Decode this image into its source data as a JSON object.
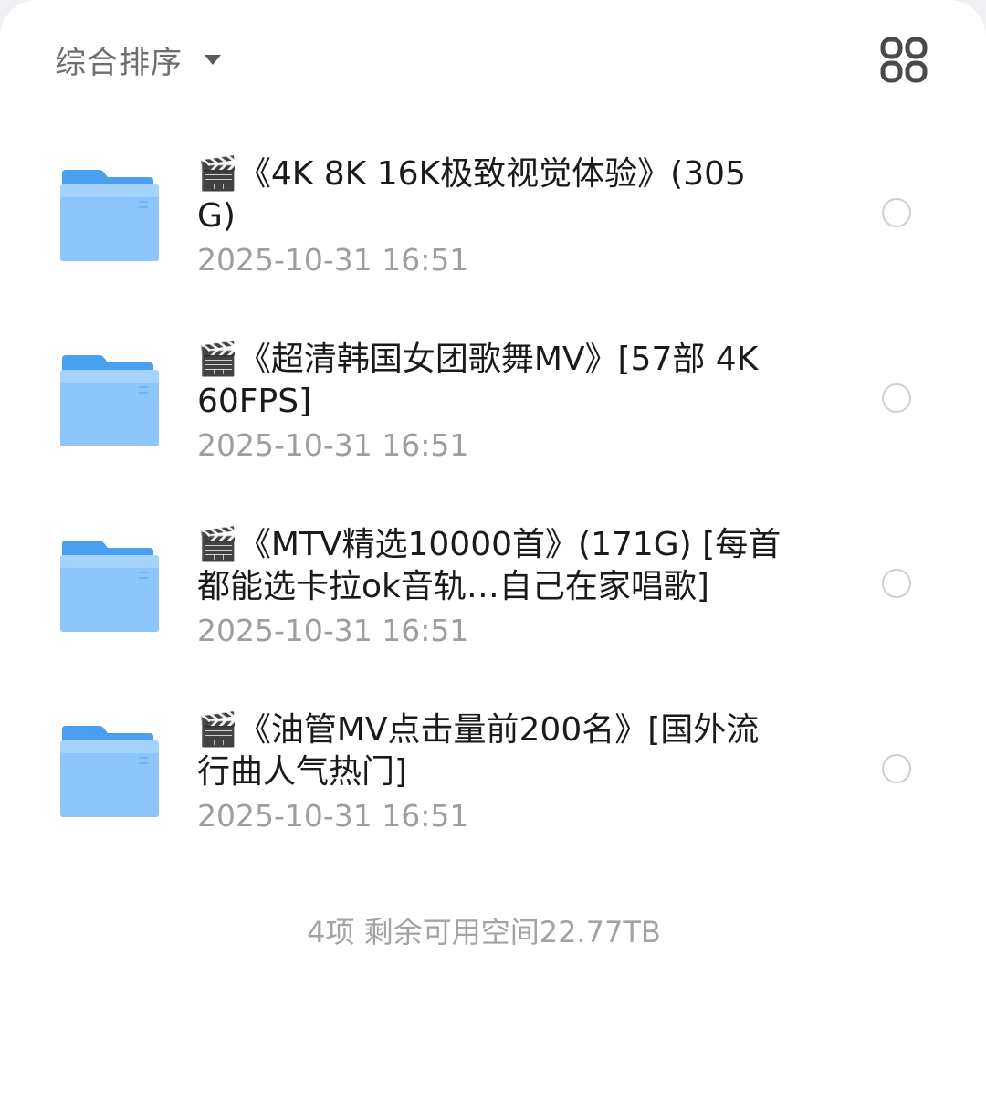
{
  "toolbar": {
    "sort_label": "综合排序",
    "sort_caret_icon": "caret-down-icon",
    "view_toggle_icon": "grid-view-icon"
  },
  "files": [
    {
      "name": "🎬《4K 8K 16K极致视觉体验》(305G)",
      "date": "2025-10-31 16:51",
      "icon": "folder-icon"
    },
    {
      "name": "🎬《超清韩国女团歌舞MV》[57部 4K 60FPS]",
      "date": "2025-10-31 16:51",
      "icon": "folder-icon"
    },
    {
      "name": "🎬《MTV精选10000首》(171G) [每首都能选卡拉ok音轨…自己在家唱歌]",
      "date": "2025-10-31 16:51",
      "icon": "folder-icon"
    },
    {
      "name": "🎬《油管MV点击量前200名》[国外流行曲人气热门]",
      "date": "2025-10-31 16:51",
      "icon": "folder-icon"
    }
  ],
  "footer": {
    "summary": "4项 剩余可用空间22.77TB"
  },
  "colors": {
    "folder_back": "#4a9ff0",
    "folder_front": "#8cc6fb",
    "text_primary": "#1a1a1a",
    "text_secondary": "#9e9e9e",
    "radio_border": "#cfcfcf"
  }
}
